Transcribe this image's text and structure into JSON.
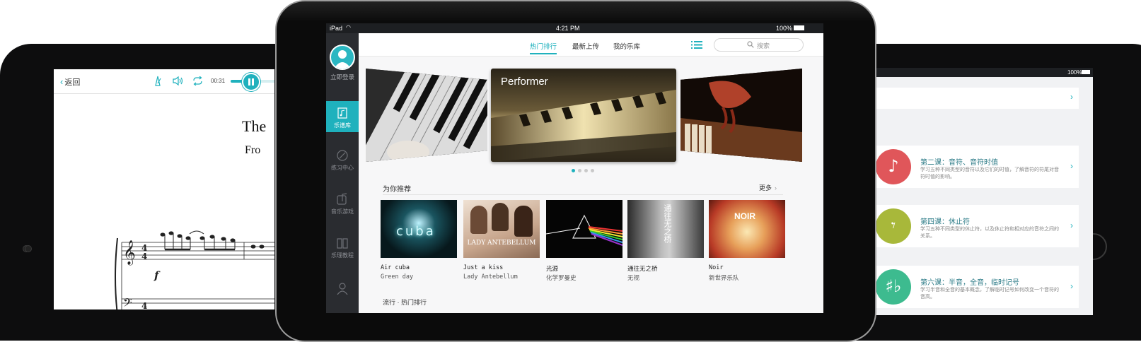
{
  "left_device": {
    "back_label": "返回",
    "time": "00:31",
    "score_title_1": "The",
    "score_title_2": "Fro",
    "dynamic_mark": "f",
    "time_sig": "4",
    "time_sig_bottom": "4"
  },
  "center_device": {
    "status": {
      "carrier": "iPad",
      "time": "4:21 PM",
      "battery": "100%"
    },
    "sidebar": {
      "login_label": "立即登录",
      "items": [
        {
          "label": "乐谱库",
          "icon": "music-book-icon",
          "active": true
        },
        {
          "label": "练习中心",
          "icon": "practice-icon",
          "active": false
        },
        {
          "label": "音乐游戏",
          "icon": "music-game-icon",
          "active": false
        },
        {
          "label": "乐理教程",
          "icon": "theory-book-icon",
          "active": false
        }
      ]
    },
    "tabs": [
      "热门排行",
      "最新上传",
      "我的乐库"
    ],
    "search_placeholder": "搜索",
    "banner_label": "Performer",
    "section_title": "为你推荐",
    "more_label": "更多",
    "albums": [
      {
        "title": "Air cuba",
        "artist": "Green day",
        "cover_text": "cuba"
      },
      {
        "title": "Just a kiss",
        "artist": "Lady Antebellum",
        "cover_text": "LADY ANTEBELLUM"
      },
      {
        "title": "光源",
        "artist": "化学罗曼史",
        "cover_text": ""
      },
      {
        "title": "通往无之桥",
        "artist": "无视",
        "cover_text": "通往无之桥"
      },
      {
        "title": "Noir",
        "artist": "新世界乐队",
        "cover_text": "NOIR"
      }
    ],
    "bottom_section": "流行 · 热门排行"
  },
  "right_device": {
    "battery": "100%",
    "lessons": [
      {
        "title": "第二课：音符、音符时值",
        "desc": "学习五种不同类型的音符以及它们的时值，了解音符的符尾对音符时值的影响。",
        "color": "#e0565a",
        "glyph": "♪"
      },
      {
        "title": "第四课：休止符",
        "desc": "学习五种不同类型的休止符，以及休止符和相对应的音符之间的关系。",
        "color": "#a8b83a",
        "glyph": "𝄾"
      },
      {
        "title": "第六课：半音，全音，临时记号",
        "desc": "学习半音和全音的基本概念，了解临时记号如何改变一个音符的音高。",
        "color": "#3dbb8f",
        "glyph": "♯♭"
      }
    ]
  }
}
